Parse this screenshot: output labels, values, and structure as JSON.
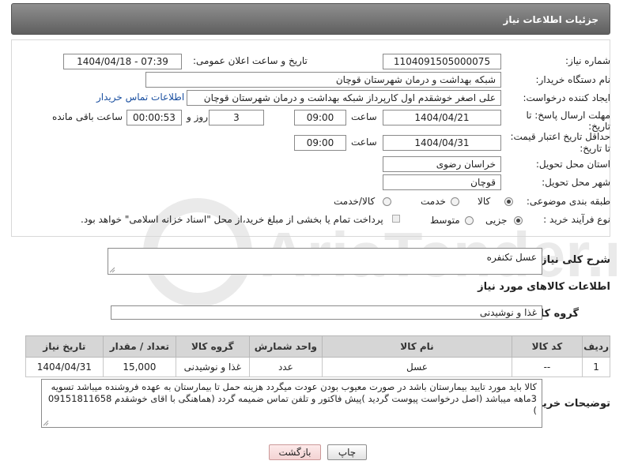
{
  "header": {
    "title": "جزئیات اطلاعات نیاز"
  },
  "fields": {
    "need_number": {
      "label": "شماره نیاز:",
      "value": "1104091505000075"
    },
    "announce_datetime": {
      "label": "تاریخ و ساعت اعلان عمومی:",
      "value": "1404/04/18 - 07:39"
    },
    "buyer_org": {
      "label": "نام دستگاه خریدار:",
      "value": "شبکه بهداشت و درمان شهرستان قوچان"
    },
    "creator": {
      "label": "ایجاد کننده درخواست:",
      "value": "علی اصغر خوشقدم اول کارپرداز شبکه بهداشت و درمان شهرستان قوچان",
      "contact_link": "اطلاعات تماس خریدار"
    },
    "reply_deadline": {
      "label_line1": "مهلت ارسال پاسخ: تا",
      "label_line2": "تاریخ:",
      "date": "1404/04/21",
      "time_label": "ساعت",
      "time": "09:00",
      "days": "3",
      "days_label": "روز و",
      "remaining": "00:00:53",
      "remaining_label": "ساعت باقی مانده"
    },
    "price_validity": {
      "label_line1": "حداقل تاریخ اعتبار قیمت:",
      "label_line2": "تا تاریخ:",
      "date": "1404/04/31",
      "time_label": "ساعت",
      "time": "09:00"
    },
    "province": {
      "label": "استان محل تحویل:",
      "value": "خراسان رضوی"
    },
    "city": {
      "label": "شهر محل تحویل:",
      "value": "قوچان"
    },
    "category": {
      "label": "طبقه بندی موضوعی:",
      "options": [
        "کالا",
        "خدمت",
        "کالا/خدمت"
      ],
      "selected": "کالا"
    },
    "process_type": {
      "label": "نوع فرآیند خرید :",
      "options": [
        "جزیی",
        "متوسط"
      ],
      "selected": "جزیی",
      "note": "پرداخت تمام یا بخشی از مبلغ خرید،از محل \"اسناد خزانه اسلامی\" خواهد بود."
    }
  },
  "description": {
    "label": "شرح کلی نیاز:",
    "value": "عسل تکنفره"
  },
  "goods_section": {
    "title": "اطلاعات کالاهای مورد نیاز"
  },
  "goods_group": {
    "label": "گروه کالا:",
    "value": "غذا و نوشیدنی"
  },
  "table": {
    "headers": [
      "ردیف",
      "کد کالا",
      "نام کالا",
      "واحد شمارش",
      "گروه کالا",
      "تعداد / مقدار",
      "تاریخ نیاز"
    ],
    "rows": [
      [
        "1",
        "--",
        "عسل",
        "عدد",
        "غذا و نوشیدنی",
        "15,000",
        "1404/04/31"
      ]
    ]
  },
  "buyer_notes": {
    "label": "توضیحات خریدار:",
    "value": "کالا باید مورد تایید بیمارستان باشد در صورت معیوب بودن عودت میگردد هزینه حمل تا بیمارستان به عهده فروشنده میباشد تسویه 3ماهه میباشد (اصل درخواست پیوست گردید )پیش فاکتور و تلفن تماس ضمیمه گردد (هماهنگی با اقای خوشقدم 09151811658 )"
  },
  "buttons": {
    "print": "چاپ",
    "back": "بازگشت"
  },
  "watermark": {
    "text": "AriaTender.net"
  },
  "colors": {
    "header_bg": "#6f6f6f",
    "link": "#1a4fa0",
    "table_header_bg": "#d6d6d6",
    "back_button_bg": "#f7dede"
  }
}
